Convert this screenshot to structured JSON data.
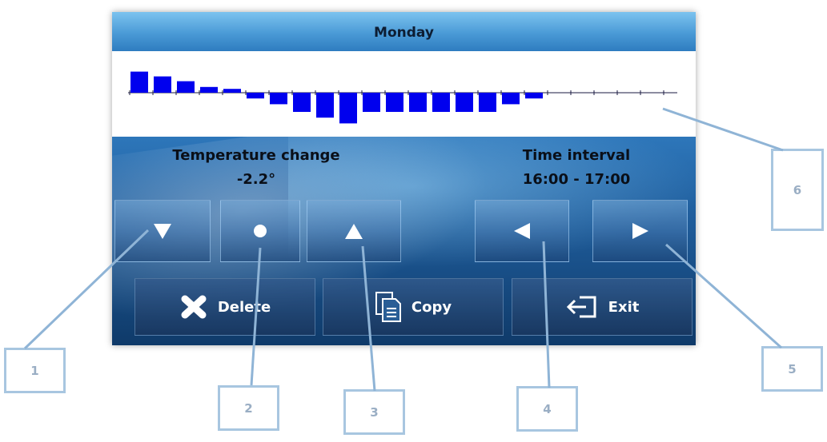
{
  "screen": {
    "title": "Monday",
    "temperature_change": {
      "label": "Temperature change",
      "value": "-2.2°"
    },
    "time_interval": {
      "label": "Time interval",
      "value": "16:00 - 17:00"
    },
    "buttons": {
      "decrease_icon": "triangle-down",
      "reset_icon": "dot",
      "increase_icon": "triangle-up",
      "previous_icon": "triangle-left",
      "next_icon": "triangle-right",
      "delete_label": "Delete",
      "delete_icon": "x-icon",
      "copy_label": "Copy",
      "copy_icon": "document-icon",
      "exit_label": "Exit",
      "exit_icon": "exit-arrow-icon"
    },
    "graph": {
      "hours": 24,
      "bar_color": "#0000ee",
      "hourly_changes": [
        2.2,
        1.7,
        1.2,
        0.6,
        0.4,
        -0.6,
        -1.2,
        -2.0,
        -2.6,
        -3.2,
        -2.0,
        -2.0,
        -2.0,
        -2.0,
        -2.0,
        -2.0,
        -1.2,
        -0.6,
        0,
        0,
        0,
        0,
        0,
        0
      ]
    }
  },
  "callouts": [
    "1",
    "2",
    "3",
    "4",
    "5",
    "6"
  ],
  "colors": {
    "callout_border": "#a8c6e0",
    "callout_text": "#9aaec4",
    "leader_line": "#8fb4d6"
  }
}
